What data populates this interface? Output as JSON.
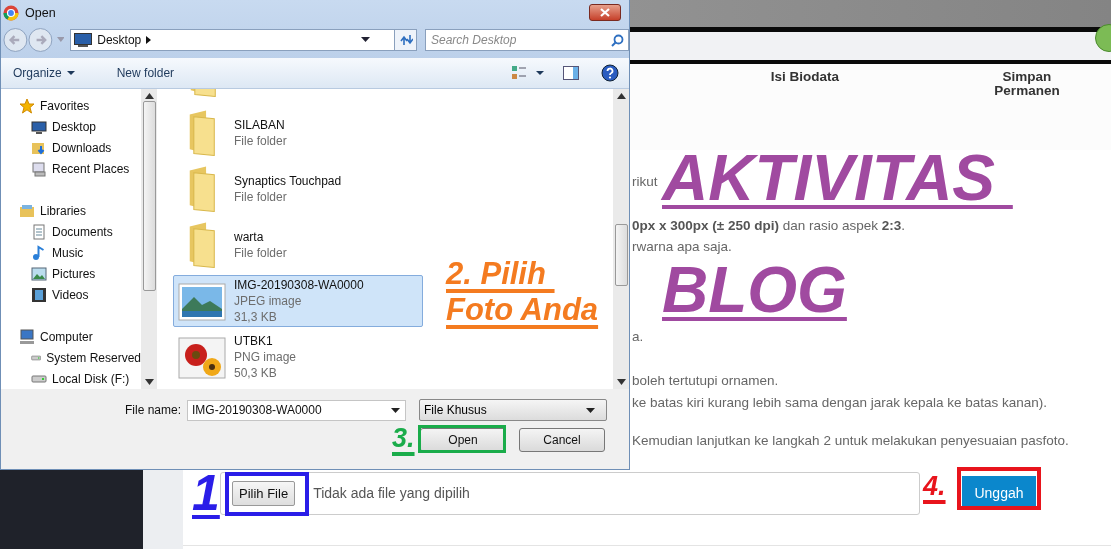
{
  "page": {
    "steps": [
      "Isi Biodata",
      "Simpan Permanen"
    ],
    "paragraphs": [
      [
        "rikut"
      ],
      [
        "**0px x 300px (± 250 dpi)** dan rasio aspek **2:3**.",
        "rwarna apa saja."
      ],
      [
        "a."
      ],
      [
        "boleh tertutupi ornamen.",
        "ke batas kiri kurang lebih sama dengan jarak kepala ke batas kanan)."
      ],
      [
        "Kemudian lanjutkan ke langkah 2 untuk melakukan penyesuaian pasfoto."
      ]
    ],
    "file_input": {
      "button": "Pilih File",
      "status": "Tidak ada file yang dipilih"
    },
    "upload_button": "Unggah"
  },
  "dialog": {
    "title": "Open",
    "address": "Desktop",
    "search": {
      "placeholder": "Search Desktop"
    },
    "toolbar": {
      "organize": "Organize",
      "new_folder": "New folder"
    },
    "nav_pane": [
      {
        "label": "Favorites",
        "kind": "star",
        "children": [
          {
            "label": "Desktop",
            "kind": "desktop"
          },
          {
            "label": "Downloads",
            "kind": "downloads"
          },
          {
            "label": "Recent Places",
            "kind": "recent"
          }
        ]
      },
      {
        "label": "Libraries",
        "kind": "library",
        "children": [
          {
            "label": "Documents",
            "kind": "document"
          },
          {
            "label": "Music",
            "kind": "music"
          },
          {
            "label": "Pictures",
            "kind": "picture"
          },
          {
            "label": "Videos",
            "kind": "video"
          }
        ]
      },
      {
        "label": "Computer",
        "kind": "computer",
        "children": [
          {
            "label": "System Reserved",
            "kind": "drive"
          },
          {
            "label": "Local Disk (F:)",
            "kind": "drive"
          }
        ]
      }
    ],
    "files": [
      {
        "name": "SILABAN",
        "type": "File folder",
        "kind": "folder",
        "selected": false
      },
      {
        "name": "Synaptics Touchpad",
        "type": "File folder",
        "kind": "folder",
        "selected": false
      },
      {
        "name": "warta",
        "type": "File folder",
        "kind": "folder",
        "selected": false
      },
      {
        "name": "IMG-20190308-WA0000",
        "type": "JPEG image",
        "size": "31,3 KB",
        "kind": "jpeg",
        "selected": true
      },
      {
        "name": "UTBK1",
        "type": "PNG image",
        "size": "50,3 KB",
        "kind": "png",
        "selected": false
      }
    ],
    "file_name_label": "File name:",
    "file_name": "IMG-20190308-WA0000",
    "filter": "File Khusus",
    "open_button": "Open",
    "cancel_button": "Cancel"
  },
  "annotations": [
    {
      "lines": [
        "2. Pilih ",
        "Foto Anda"
      ],
      "color": "#f47b20"
    },
    {
      "lines": [
        "AKTIVITAS ",
        "BLOG"
      ],
      "color": "#a04aa0"
    },
    {
      "lines": [
        "1"
      ],
      "color": "#2a1de8"
    },
    {
      "lines": [
        "3."
      ],
      "color": "#1aac4a"
    },
    {
      "lines": [
        "4."
      ],
      "color": "#e8141c"
    }
  ],
  "frames": [
    {
      "color": "#2a1de8"
    },
    {
      "color": "#1aac4a"
    },
    {
      "color": "#e8141c"
    }
  ]
}
